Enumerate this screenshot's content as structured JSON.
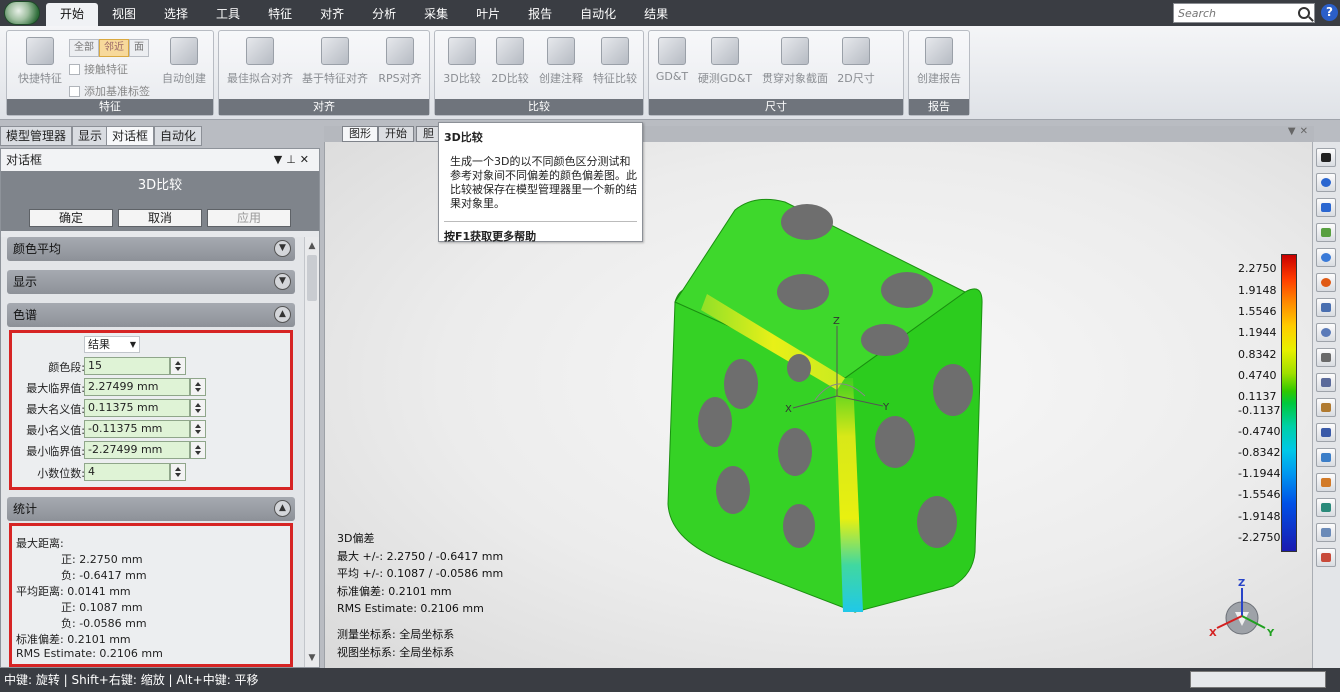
{
  "menu": {
    "tabs": [
      "开始",
      "视图",
      "选择",
      "工具",
      "特征",
      "对齐",
      "分析",
      "采集",
      "叶片",
      "报告",
      "自动化",
      "结果"
    ],
    "active_index": 0
  },
  "search": {
    "placeholder": "Search"
  },
  "ribbon": {
    "features": {
      "label": "特征",
      "quick": "快捷特征",
      "seg": [
        "全部",
        "邻近",
        "面"
      ],
      "seg_selected": 1,
      "contact": "接触特征",
      "add_datum": "添加基准标签",
      "auto_create": "自动创建"
    },
    "align": {
      "label": "对齐",
      "best_fit": "最佳拟合对齐",
      "feature_based": "基于特征对齐",
      "rps": "RPS对齐"
    },
    "compare": {
      "label": "比较",
      "compare_3d": "3D比较",
      "compare_2d": "2D比较",
      "create_annot": "创建注释",
      "feature_compare": "特征比较"
    },
    "dimension": {
      "label": "尺寸",
      "gdt": "GD&T",
      "probe_gdt": "硬测GD&T",
      "through_section": "贯穿对象截面",
      "dim_2d": "2D尺寸"
    },
    "report": {
      "label": "报告",
      "create_report": "创建报告"
    }
  },
  "subtabs": [
    "模型管理器",
    "显示",
    "对话框",
    "自动化"
  ],
  "subtab_active": 2,
  "panel": {
    "title": "对话框",
    "dialog_title": "3D比较",
    "ok": "确定",
    "cancel": "取消",
    "apply": "应用",
    "sections": {
      "color_avg": "颜色平均",
      "display": "显示",
      "spectrum": "色谱",
      "stats": "统计"
    },
    "spectrum": {
      "result_select": "结果",
      "fields": [
        {
          "label": "颜色段:",
          "value": "15"
        },
        {
          "label": "最大临界值:",
          "value": "2.27499 mm"
        },
        {
          "label": "最大名义值:",
          "value": "0.11375 mm"
        },
        {
          "label": "最小名义值:",
          "value": "-0.11375 mm"
        },
        {
          "label": "最小临界值:",
          "value": "-2.27499 mm"
        },
        {
          "label": "小数位数:",
          "value": "4"
        }
      ]
    },
    "stats": {
      "lines": [
        "最大距离:",
        "正: 2.2750 mm",
        "负: -0.6417 mm",
        "平均距离: 0.0141 mm",
        "正: 0.1087 mm",
        "负: -0.0586 mm",
        "标准偏差: 0.2101 mm",
        "RMS Estimate: 0.2106 mm"
      ]
    }
  },
  "view_tabs": [
    "图形",
    "开始",
    "胆"
  ],
  "tooltip": {
    "title": "3D比较",
    "body": "生成一个3D的以不同颜色区分测试和参考对象间不同偏差的颜色偏差图。此比较被保存在模型管理器里一个新的结果对象里。",
    "help": "按F1获取更多帮助"
  },
  "scale": {
    "labels": [
      "2.2750",
      "1.9148",
      "1.5546",
      "1.1944",
      "0.8342",
      "0.4740",
      "0.1137",
      "-0.1137",
      "-0.4740",
      "-0.8342",
      "-1.1944",
      "-1.5546",
      "-1.9148",
      "-2.2750"
    ]
  },
  "info": {
    "lines": [
      "3D偏差",
      "最大 +/-: 2.2750 / -0.6417 mm",
      "平均 +/-: 0.1087 / -0.0586 mm",
      "标准偏差: 0.2101 mm",
      "RMS Estimate: 0.2106 mm",
      "测量坐标系: 全局坐标系",
      "视图坐标系: 全局坐标系"
    ]
  },
  "axes": {
    "x": "X",
    "y": "Y",
    "z": "Z"
  },
  "status": {
    "text": "中键: 旋转 | Shift+右键: 缩放 | Alt+中键: 平移"
  },
  "colors": {
    "menubar": "#3a3d43",
    "highlight_box": "#d62424",
    "mesh_green": "#2ccc1e"
  }
}
